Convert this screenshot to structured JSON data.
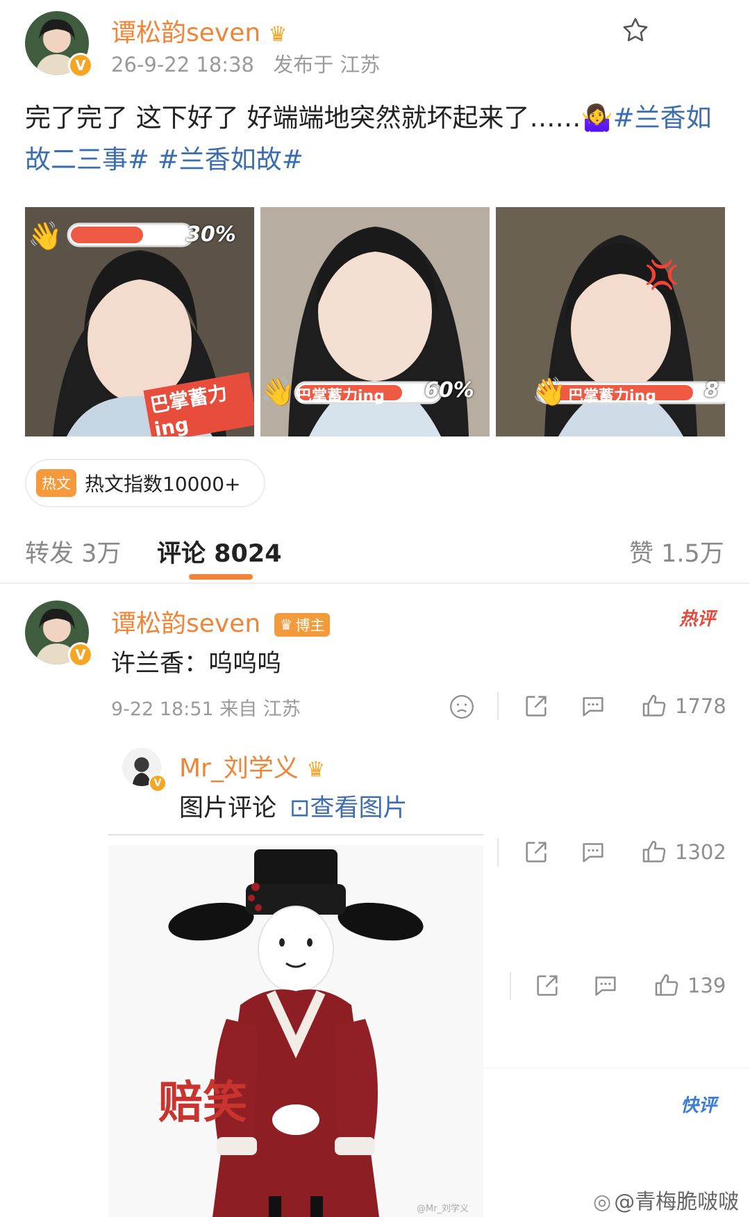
{
  "post": {
    "author": "谭松韵seven",
    "time": "26-9-22 18:38",
    "location": "发布于 江苏",
    "text": "完了完了 这下好了 好端端地突然就坏起来了……🤷‍♀️",
    "hashtags": [
      "#兰香如故二三事#",
      "#兰香如故#"
    ],
    "photos": [
      {
        "progress_label": "30%",
        "banner": "巴掌蓄力ing",
        "progress": 0.3
      },
      {
        "progress_label": "60%",
        "banner": "巴掌蓄力ing",
        "progress": 0.6
      },
      {
        "progress_label": "8",
        "banner": "巴掌蓄力ing",
        "progress": 0.85
      }
    ],
    "hot_tag": "热文",
    "hot_index": "热文指数10000+"
  },
  "tabs": {
    "repost": "转发 3万",
    "comment": "评论 8024",
    "like": "赞 1.5万"
  },
  "comment1": {
    "author": "谭松韵seven",
    "badge": "博主",
    "hot_mark": "热评",
    "text": "许兰香：呜呜呜",
    "time": "9-22 18:51 来自 江苏",
    "likes": "1778"
  },
  "reply1": {
    "author": "Mr_刘学义",
    "text": "图片评论",
    "link": "⊡查看图片"
  },
  "actions2": {
    "likes": "1302"
  },
  "actions3": {
    "likes": "139"
  },
  "sticker": {
    "caption": "赔笑",
    "mark": "@Mr_刘学义"
  },
  "fast_mark": "快评",
  "watermark": "@青梅脆啵啵",
  "colors": {
    "accent": "#f08437",
    "link": "#3b6eaf",
    "hot": "#e24b3a"
  }
}
